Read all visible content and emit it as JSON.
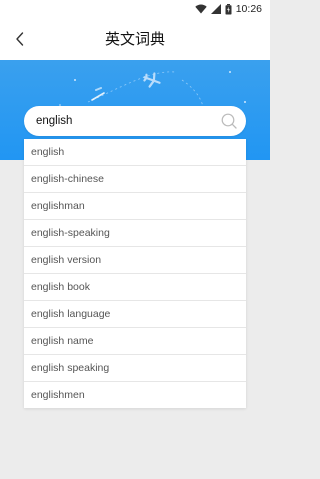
{
  "status_bar": {
    "time": "10:26",
    "icons": [
      "wifi-icon",
      "signal-icon",
      "battery-icon"
    ]
  },
  "header": {
    "title": "英文词典",
    "back_icon": "back-chevron-icon"
  },
  "banner": {
    "color": "#2196f3",
    "decorations": [
      "airplane-icon",
      "paper-plane-icon"
    ]
  },
  "search": {
    "value": "english",
    "icon": "search-icon"
  },
  "suggestions": [
    "english",
    "english-chinese",
    "englishman",
    "english-speaking",
    "english version",
    "english book",
    "english language",
    "english name",
    "english speaking",
    "englishmen"
  ]
}
